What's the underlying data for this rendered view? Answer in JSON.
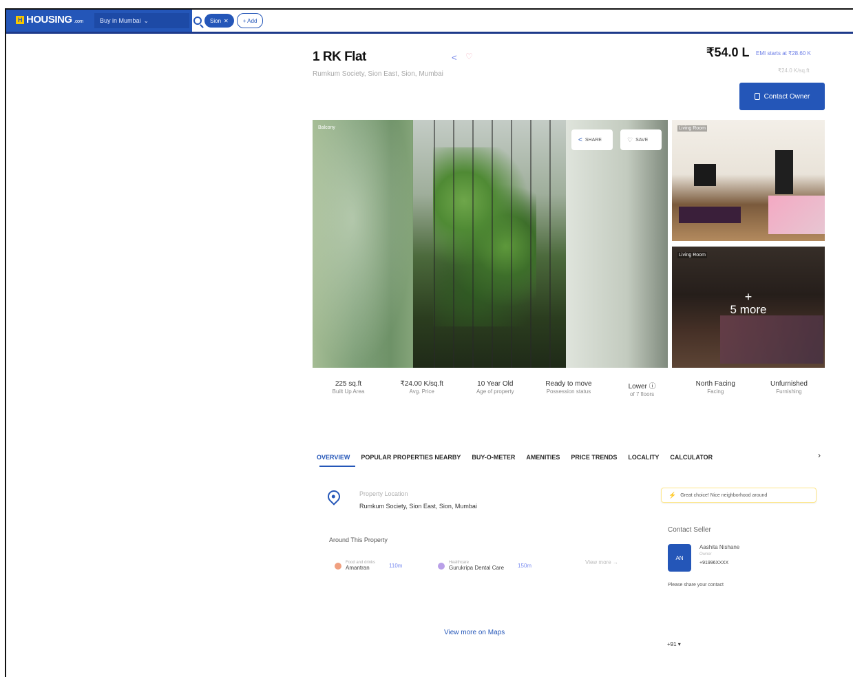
{
  "nav": {
    "logo_text": "HOUSING",
    "logo_suffix": ".com",
    "logo_mark": "H",
    "city_select": "Buy in Mumbai",
    "search_chip": "Sion",
    "add_chip": "+ Add"
  },
  "listing": {
    "title": "1 RK Flat",
    "subtitle": "Rumkum Society, Sion East, Sion, Mumbai",
    "price": "₹54.0 L",
    "emi": "EMI starts at ₹28.60 K",
    "per_sqft": "₹24.0 K/sq.ft",
    "contact_label": "Contact Owner"
  },
  "gallery": {
    "main_tag": "Balcony",
    "share_label": "SHARE",
    "save_label": "SAVE",
    "side_top_tag": "Living Room",
    "side_bottom_tag": "Living Room",
    "more_plus": "+",
    "more_label": "5 more"
  },
  "stats": [
    {
      "value": "225 sq.ft",
      "label": "Built Up Area"
    },
    {
      "value": "₹24.00 K/sq.ft",
      "label": "Avg. Price"
    },
    {
      "value": "10 Year Old",
      "label": "Age of property"
    },
    {
      "value": "Ready to move",
      "label": "Possession status"
    },
    {
      "value": "Lower",
      "label": "of 7 floors"
    },
    {
      "value": "North Facing",
      "label": "Facing"
    },
    {
      "value": "Unfurnished",
      "label": "Furnishing"
    }
  ],
  "tabs": [
    "OVERVIEW",
    "POPULAR PROPERTIES NEARBY",
    "BUY-O-METER",
    "AMENITIES",
    "PRICE TRENDS",
    "LOCALITY",
    "CALCULATOR"
  ],
  "overview": {
    "location_label": "Property Location",
    "location_value": "Rumkum Society, Sion East, Sion, Mumbai",
    "around_title": "Around This Property",
    "nearby": [
      {
        "category": "Food and drinks",
        "name": "Amantran",
        "distance": "110m"
      },
      {
        "category": "Healthcare",
        "name": "Gurukripa Dental Care",
        "distance": "150m"
      }
    ],
    "nearby_more": "View more"
  },
  "highlight": "Great choice! Nice neighborhood around",
  "seller": {
    "title": "Contact Seller",
    "avatar": "AN",
    "name": "Aashita Nishane",
    "sub": "Owner",
    "phone": "+91996XXXX",
    "note": "Please share your contact"
  },
  "footer": {
    "view_more_maps": "View more on Maps",
    "country_code": "+91 ▾"
  },
  "colors": {
    "brand": "#2456b8",
    "accent_light": "#6b7de6",
    "highlight_border": "#fde68a"
  }
}
